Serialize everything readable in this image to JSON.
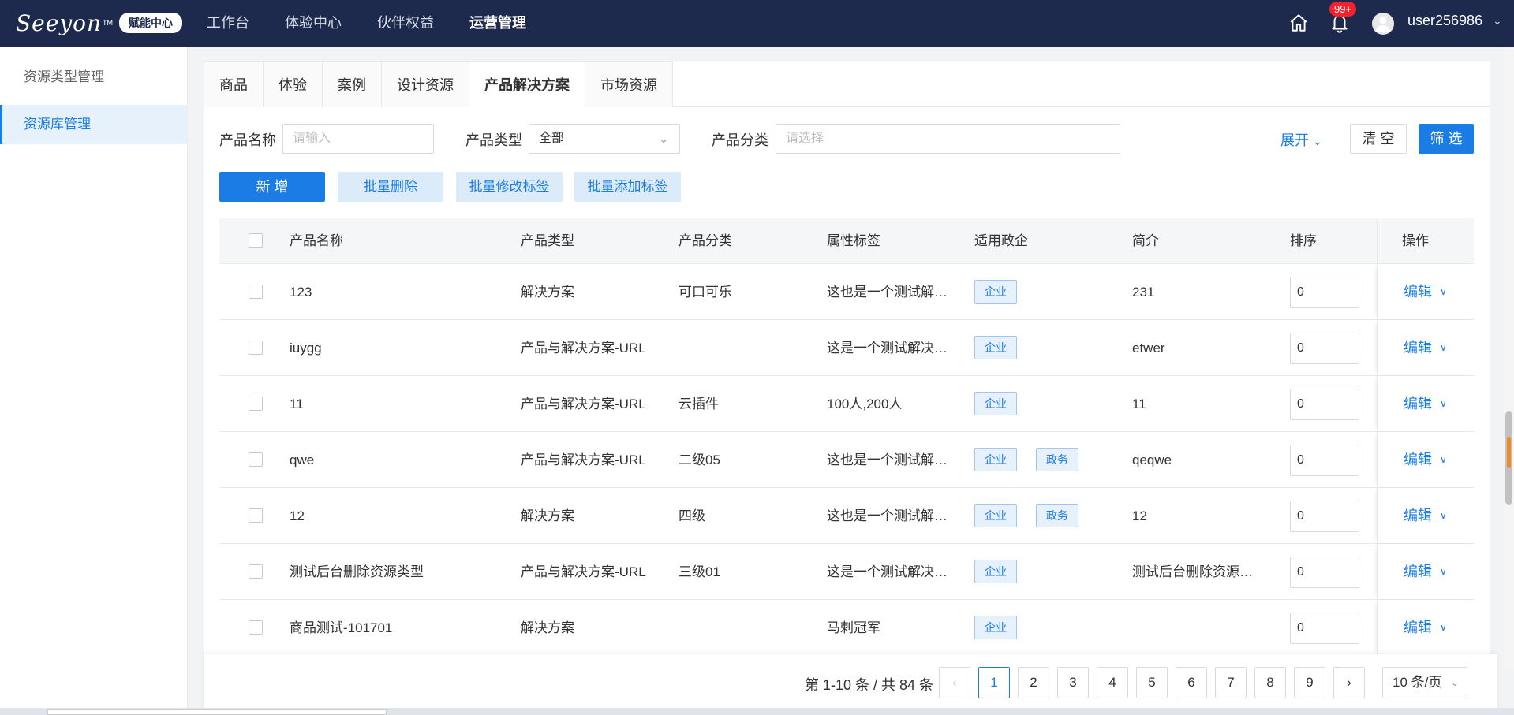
{
  "header": {
    "logo_text": "Seeyon",
    "logo_tm": "TM",
    "logo_badge": "赋能中心",
    "nav": [
      "工作台",
      "体验中心",
      "伙伴权益",
      "运营管理"
    ],
    "notification_count": "99+",
    "username": "user256986"
  },
  "sidebar": {
    "items": [
      {
        "label": "资源类型管理"
      },
      {
        "label": "资源库管理"
      }
    ]
  },
  "tabs": [
    "商品",
    "体验",
    "案例",
    "设计资源",
    "产品解决方案",
    "市场资源"
  ],
  "filters": {
    "name_label": "产品名称",
    "name_placeholder": "请输入",
    "type_label": "产品类型",
    "type_value": "全部",
    "category_label": "产品分类",
    "category_placeholder": "请选择",
    "expand_label": "展开",
    "clear_label": "清 空",
    "filter_label": "筛 选"
  },
  "actions": {
    "new_label": "新 增",
    "batch_delete": "批量删除",
    "batch_edit_tags": "批量修改标签",
    "batch_add_tags": "批量添加标签"
  },
  "table": {
    "columns": [
      "产品名称",
      "产品类型",
      "产品分类",
      "属性标签",
      "适用政企",
      "简介",
      "排序",
      "操作"
    ],
    "rows": [
      {
        "name": "123",
        "type": "解决方案",
        "category": "可口可乐",
        "tags": "这也是一个测试解…",
        "applicable": [
          "企业"
        ],
        "intro": "231",
        "sort": "0",
        "op": "编辑"
      },
      {
        "name": "iuygg",
        "type": "产品与解决方案-URL",
        "category": "",
        "tags": "这是一个测试解决…",
        "applicable": [
          "企业"
        ],
        "intro": "etwer",
        "sort": "0",
        "op": "编辑"
      },
      {
        "name": "11",
        "type": "产品与解决方案-URL",
        "category": "云插件",
        "tags": "100人,200人",
        "applicable": [
          "企业"
        ],
        "intro": "11",
        "sort": "0",
        "op": "编辑"
      },
      {
        "name": "qwe",
        "type": "产品与解决方案-URL",
        "category": "二级05",
        "tags": "这也是一个测试解…",
        "applicable": [
          "企业",
          "政务"
        ],
        "intro": "qeqwe",
        "sort": "0",
        "op": "编辑"
      },
      {
        "name": "12",
        "type": "解决方案",
        "category": "四级",
        "tags": "这也是一个测试解…",
        "applicable": [
          "企业",
          "政务"
        ],
        "intro": "12",
        "sort": "0",
        "op": "编辑"
      },
      {
        "name": "测试后台删除资源类型",
        "type": "产品与解决方案-URL",
        "category": "三级01",
        "tags": "这是一个测试解决…",
        "applicable": [
          "企业"
        ],
        "intro": "测试后台删除资源…",
        "sort": "0",
        "op": "编辑"
      },
      {
        "name": "商品测试-101701",
        "type": "解决方案",
        "category": "",
        "tags": "马刺冠军",
        "applicable": [
          "企业"
        ],
        "intro": "",
        "sort": "0",
        "op": "编辑"
      }
    ]
  },
  "pagination": {
    "info": "第 1-10 条 / 共 84 条",
    "pages": [
      "1",
      "2",
      "3",
      "4",
      "5",
      "6",
      "7",
      "8",
      "9"
    ],
    "current": "1",
    "page_size": "10 条/页"
  },
  "colors": {
    "nav_bg": "#1d2a4d",
    "primary": "#1b7ce6",
    "light_primary": "#dcebfa",
    "badge_red": "#f5222d"
  }
}
